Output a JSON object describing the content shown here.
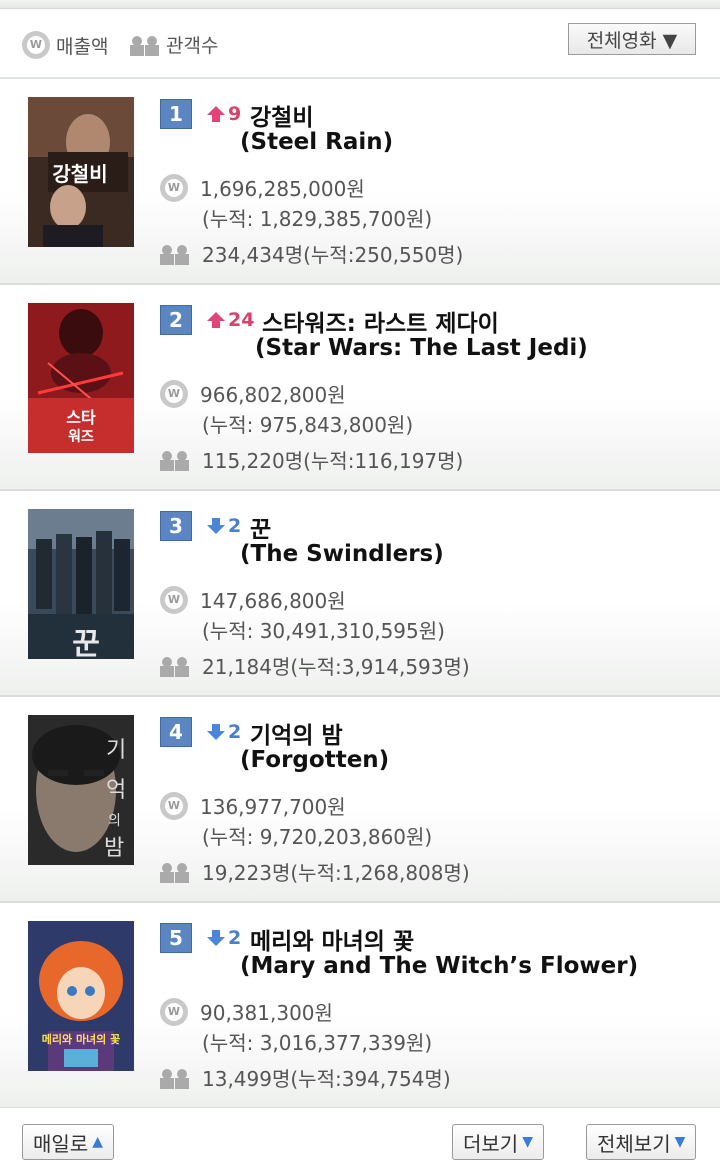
{
  "legend": {
    "sales_label": "매출액",
    "audience_label": "관객수"
  },
  "filter": {
    "selected": "전체영화 ▼"
  },
  "movies": [
    {
      "rank": "1",
      "change": "9",
      "direction": "up",
      "title_ko": "강철비",
      "title_en": "(Steel Rain)",
      "sales": "1,696,285,000원",
      "cumulative_sales": "(누적: 1,829,385,700원)",
      "audience": "234,434명(누적:250,550명)"
    },
    {
      "rank": "2",
      "change": "24",
      "direction": "up",
      "title_ko": "스타워즈: 라스트 제다이",
      "title_en": "(Star Wars: The Last Jedi)",
      "sales": "966,802,800원",
      "cumulative_sales": "(누적: 975,843,800원)",
      "audience": "115,220명(누적:116,197명)"
    },
    {
      "rank": "3",
      "change": "2",
      "direction": "down",
      "title_ko": "꾼",
      "title_en": "(The Swindlers)",
      "sales": "147,686,800원",
      "cumulative_sales": "(누적: 30,491,310,595원)",
      "audience": "21,184명(누적:3,914,593명)"
    },
    {
      "rank": "4",
      "change": "2",
      "direction": "down",
      "title_ko": "기억의 밤",
      "title_en": "(Forgotten)",
      "sales": "136,977,700원",
      "cumulative_sales": "(누적: 9,720,203,860원)",
      "audience": "19,223명(누적:1,268,808명)"
    },
    {
      "rank": "5",
      "change": "2",
      "direction": "down",
      "title_ko": "메리와 마녀의 꽃",
      "title_en": "(Mary and The Witch’s Flower)",
      "sales": "90,381,300원",
      "cumulative_sales": "(누적: 3,016,377,339원)",
      "audience": "13,499명(누적:394,754명)"
    }
  ],
  "footer": {
    "left_button": "매일로",
    "more_button": "더보기",
    "all_button": "전체보기"
  },
  "colors": {
    "up": "#d9406c",
    "down": "#4a7fcf",
    "rank_badge": "#5c86c2"
  }
}
